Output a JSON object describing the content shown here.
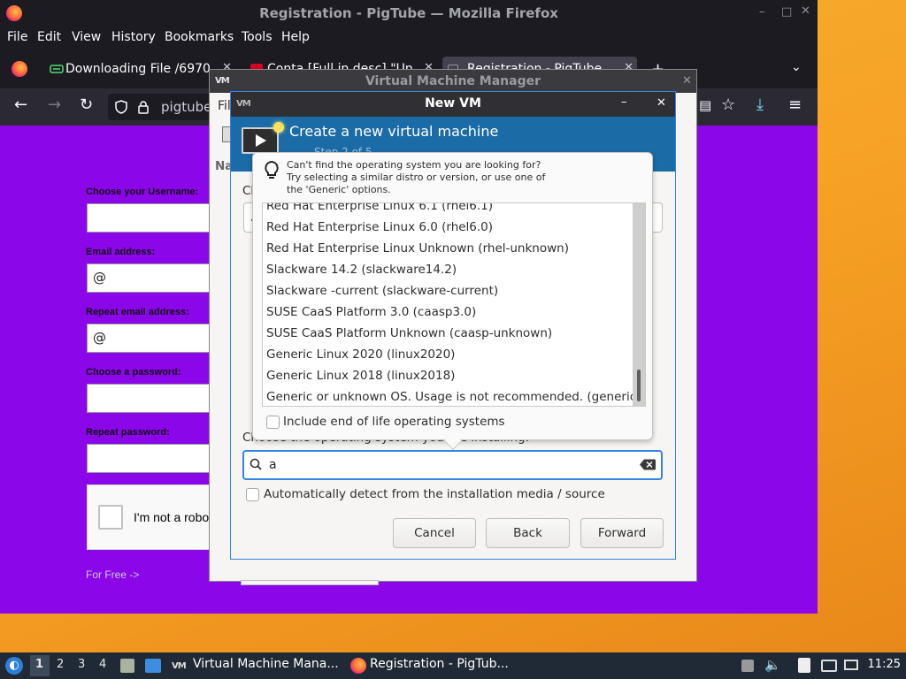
{
  "firefox": {
    "window_title": "Registration - PigTube — Mozilla Firefox",
    "menu": [
      "File",
      "Edit",
      "View",
      "History",
      "Bookmarks",
      "Tools",
      "Help"
    ],
    "tabs": [
      {
        "label": "Downloading File /6970"
      },
      {
        "label": "Conta [Full in desc] \"Un"
      },
      {
        "label": "Registration - PigTube"
      }
    ],
    "url": "pigtube"
  },
  "webpage": {
    "username_label": "Choose your Username:",
    "email_label": "Email address:",
    "email_value": "@",
    "repeat_email_label": "Repeat email address:",
    "repeat_email_value": "@",
    "password_label": "Choose a password:",
    "repeat_password_label": "Repeat password:",
    "captcha_text": "I'm not a robot",
    "for_free": "For Free ->",
    "bg_color": "#8c06ea"
  },
  "vmm": {
    "title": "Virtual Machine Manager",
    "menu_first": "Fil",
    "col_fragment": "Na"
  },
  "newvm": {
    "title": "New VM",
    "heading": "Create a new virtual machine",
    "step": "Step 2 of 5",
    "hint_line1": "Can't find the operating system you are looking for?",
    "hint_line2": "Try selecting a similar distro or version, or use one of",
    "hint_line3": "the 'Generic' options.",
    "os_items": [
      "Red Hat Enterprise Linux 6.1 (rhel6.1)",
      "Red Hat Enterprise Linux 6.0 (rhel6.0)",
      "Red Hat Enterprise Linux Unknown (rhel-unknown)",
      "Slackware 14.2 (slackware14.2)",
      "Slackware -current (slackware-current)",
      "SUSE CaaS Platform 3.0 (caasp3.0)",
      "SUSE CaaS Platform Unknown (caasp-unknown)",
      "Generic Linux 2020 (linux2020)",
      "Generic Linux 2018 (linux2018)",
      "Generic or unknown OS. Usage is not recommended. (generic)"
    ],
    "eol_label": "Include end of life operating systems",
    "choose_label": "Choose the operating system you are installing:",
    "search_value": "a",
    "auto_detect_label": "Automatically detect from the installation media / source",
    "cancel": "Cancel",
    "back": "Back",
    "forward": "Forward",
    "install_frag_ch": "Ch",
    "install_frag_slash": "/"
  },
  "taskbar": {
    "workspaces": [
      "1",
      "2",
      "3",
      "4"
    ],
    "tasks": [
      {
        "label": "Virtual Machine Mana..."
      },
      {
        "label": "Registration - PigTub..."
      }
    ],
    "clock": "11:25"
  }
}
